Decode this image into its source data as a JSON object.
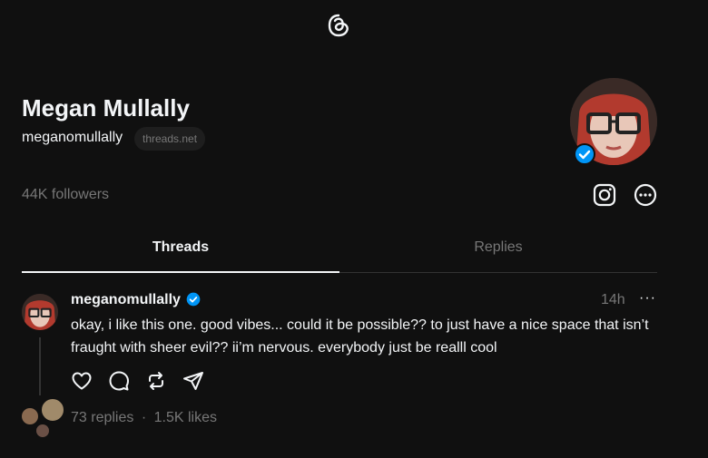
{
  "profile": {
    "name": "Megan Mullally",
    "handle": "meganomullally",
    "domain_badge": "threads.net",
    "followers": "44K followers"
  },
  "tabs": [
    {
      "label": "Threads",
      "active": true
    },
    {
      "label": "Replies",
      "active": false
    }
  ],
  "post": {
    "username": "meganomullally",
    "time": "14h",
    "more": "···",
    "text": "okay, i like this one. good vibes... could it be possible?? to just have a nice space that isn’t fraught with sheer evil?? ii’m nervous. everybody just be realll cool",
    "replies": "73 replies",
    "separator": "·",
    "likes": "1.5K likes"
  },
  "colors": {
    "background": "#101010",
    "text": "#f3f5f7",
    "muted": "#777777",
    "verified": "#0095f6"
  },
  "icons": [
    "threads-logo-icon",
    "verified-icon",
    "instagram-icon",
    "more-circle-icon",
    "heart-icon",
    "comment-icon",
    "repost-icon",
    "share-icon"
  ]
}
